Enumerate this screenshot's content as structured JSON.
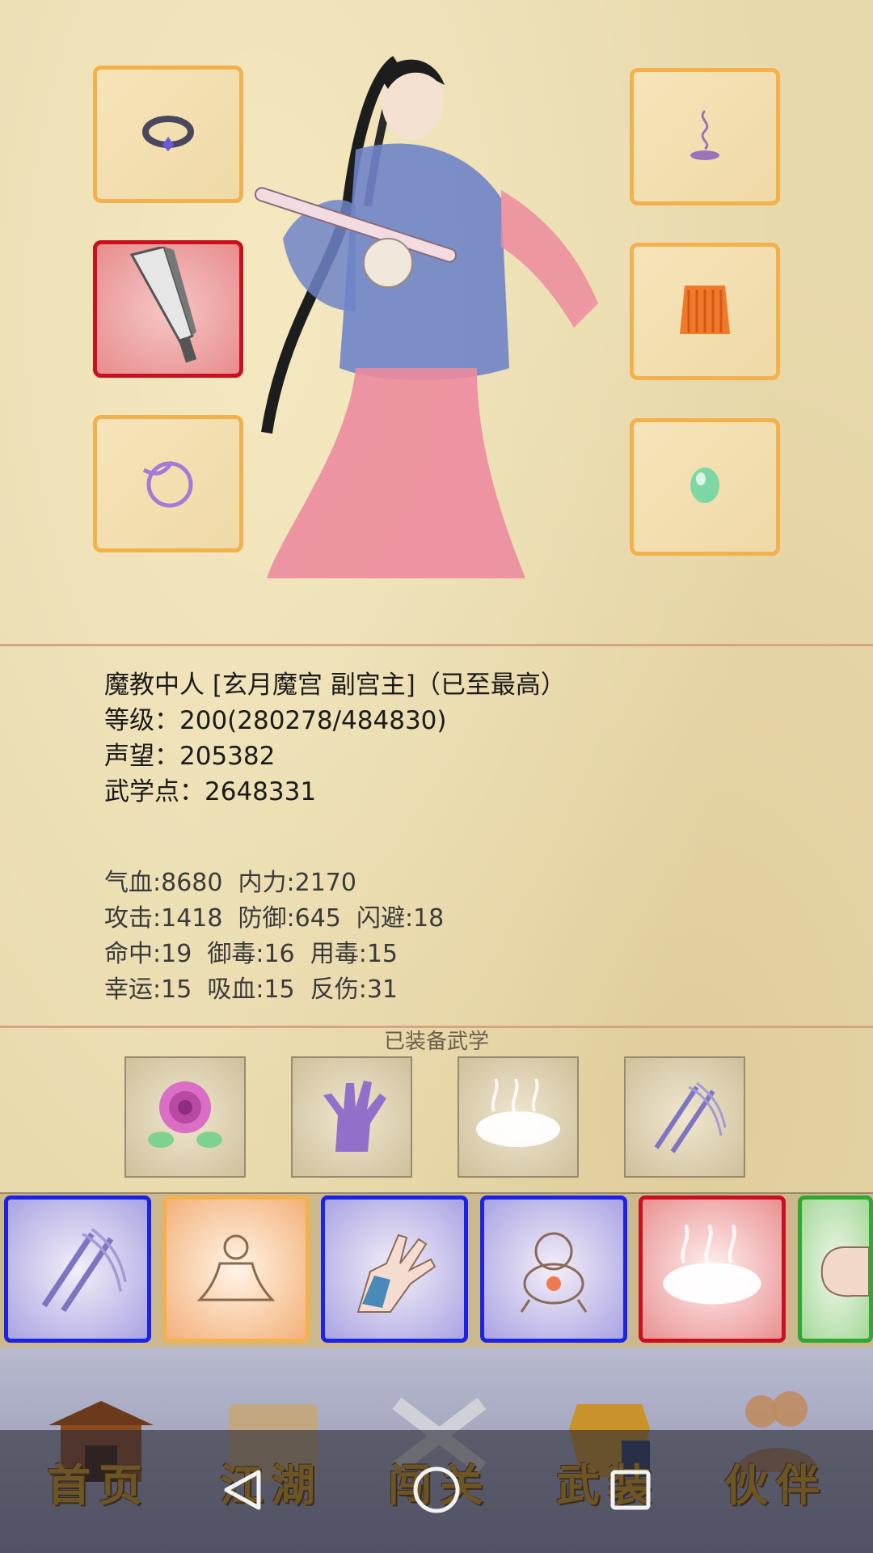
{
  "character": {
    "identity": "魔教中人 [玄月魔宫 副宫主]（已至最高）",
    "level_line": "等级：200(280278/484830)",
    "reputation_line": "声望：205382",
    "martial_points_line": "武学点：2648331"
  },
  "attributes": {
    "line1": "气血:8680  内力:2170",
    "line2": "攻击:1418  防御:645  闪避:18",
    "line3": "命中:19  御毒:16  用毒:15",
    "line4": "幸运:15  吸血:15  反伤:31"
  },
  "equipped_section": {
    "title": "已装备武学"
  },
  "equipment_slots": {
    "left": [
      "ring-icon",
      "broadsword-icon",
      "bracelet-icon"
    ],
    "right": [
      "incense-icon",
      "robe-icon",
      "jade-icon"
    ]
  },
  "equipped_skills": [
    "rose-icon",
    "palm-icon",
    "mist-icon",
    "crossed-blades-icon"
  ],
  "skill_bar": [
    {
      "icon": "crossed-blades-icon",
      "rarity": "blue"
    },
    {
      "icon": "meditation-icon",
      "rarity": "orange"
    },
    {
      "icon": "claw-hand-icon",
      "rarity": "blue"
    },
    {
      "icon": "cauldron-icon",
      "rarity": "blue"
    },
    {
      "icon": "mist-icon",
      "rarity": "red"
    },
    {
      "icon": "fist-icon",
      "rarity": "green"
    }
  ],
  "nav": [
    {
      "label": "首页",
      "icon": "pavilion-icon"
    },
    {
      "label": "江湖",
      "icon": "scroll-icon"
    },
    {
      "label": "闯关",
      "icon": "crossed-swords-icon"
    },
    {
      "label": "武装",
      "icon": "armor-icon"
    },
    {
      "label": "伙伴",
      "icon": "companions-icon"
    }
  ],
  "colors": {
    "slot_border": "#f3b14d",
    "slot_red": "#c8101e",
    "rarity_blue": "#1b23e6",
    "rarity_green": "#2ea82e",
    "nav_text": "#d89a14"
  }
}
